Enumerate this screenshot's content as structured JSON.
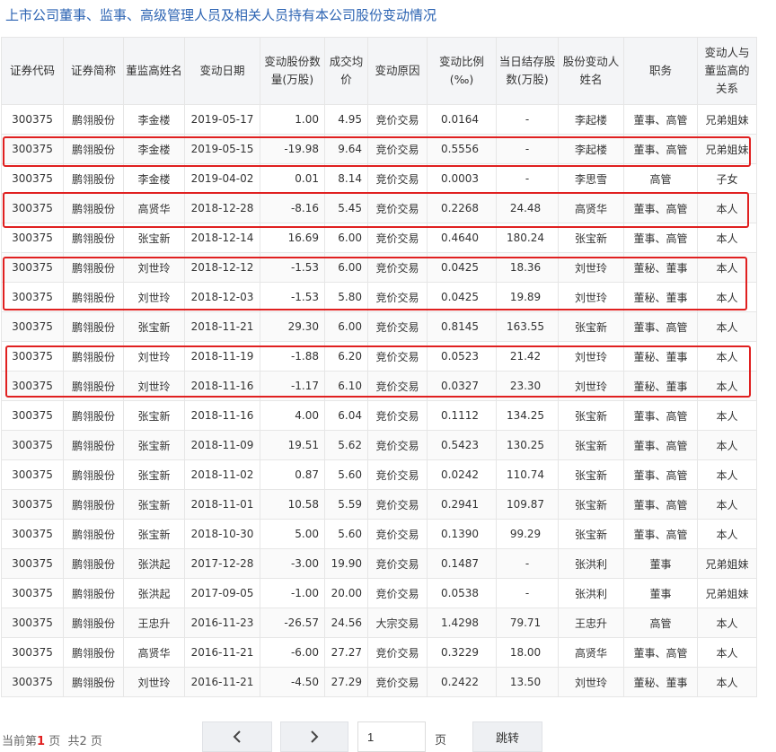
{
  "page_title": "上市公司董事、监事、高级管理人员及相关人员持有本公司股份变动情况",
  "table": {
    "headers": [
      "证券代码",
      "证券简称",
      "董监高姓名",
      "变动日期",
      "变动股份数量(万股)",
      "成交均价",
      "变动原因",
      "变动比例(‰)",
      "当日结存股数(万股)",
      "股份变动人姓名",
      "职务",
      "变动人与董监高的关系"
    ],
    "rows": [
      [
        "300375",
        "鹏翎股份",
        "李金楼",
        "2019-05-17",
        "1.00",
        "4.95",
        "竞价交易",
        "0.0164",
        "-",
        "李起楼",
        "董事、高管",
        "兄弟姐妹"
      ],
      [
        "300375",
        "鹏翎股份",
        "李金楼",
        "2019-05-15",
        "-19.98",
        "9.64",
        "竞价交易",
        "0.5556",
        "-",
        "李起楼",
        "董事、高管",
        "兄弟姐妹"
      ],
      [
        "300375",
        "鹏翎股份",
        "李金楼",
        "2019-04-02",
        "0.01",
        "8.14",
        "竞价交易",
        "0.0003",
        "-",
        "李思雪",
        "高管",
        "子女"
      ],
      [
        "300375",
        "鹏翎股份",
        "高贤华",
        "2018-12-28",
        "-8.16",
        "5.45",
        "竞价交易",
        "0.2268",
        "24.48",
        "高贤华",
        "董事、高管",
        "本人"
      ],
      [
        "300375",
        "鹏翎股份",
        "张宝新",
        "2018-12-14",
        "16.69",
        "6.00",
        "竞价交易",
        "0.4640",
        "180.24",
        "张宝新",
        "董事、高管",
        "本人"
      ],
      [
        "300375",
        "鹏翎股份",
        "刘世玲",
        "2018-12-12",
        "-1.53",
        "6.00",
        "竞价交易",
        "0.0425",
        "18.36",
        "刘世玲",
        "董秘、董事",
        "本人"
      ],
      [
        "300375",
        "鹏翎股份",
        "刘世玲",
        "2018-12-03",
        "-1.53",
        "5.80",
        "竞价交易",
        "0.0425",
        "19.89",
        "刘世玲",
        "董秘、董事",
        "本人"
      ],
      [
        "300375",
        "鹏翎股份",
        "张宝新",
        "2018-11-21",
        "29.30",
        "6.00",
        "竞价交易",
        "0.8145",
        "163.55",
        "张宝新",
        "董事、高管",
        "本人"
      ],
      [
        "300375",
        "鹏翎股份",
        "刘世玲",
        "2018-11-19",
        "-1.88",
        "6.20",
        "竞价交易",
        "0.0523",
        "21.42",
        "刘世玲",
        "董秘、董事",
        "本人"
      ],
      [
        "300375",
        "鹏翎股份",
        "刘世玲",
        "2018-11-16",
        "-1.17",
        "6.10",
        "竞价交易",
        "0.0327",
        "23.30",
        "刘世玲",
        "董秘、董事",
        "本人"
      ],
      [
        "300375",
        "鹏翎股份",
        "张宝新",
        "2018-11-16",
        "4.00",
        "6.04",
        "竞价交易",
        "0.1112",
        "134.25",
        "张宝新",
        "董事、高管",
        "本人"
      ],
      [
        "300375",
        "鹏翎股份",
        "张宝新",
        "2018-11-09",
        "19.51",
        "5.62",
        "竞价交易",
        "0.5423",
        "130.25",
        "张宝新",
        "董事、高管",
        "本人"
      ],
      [
        "300375",
        "鹏翎股份",
        "张宝新",
        "2018-11-02",
        "0.87",
        "5.60",
        "竞价交易",
        "0.0242",
        "110.74",
        "张宝新",
        "董事、高管",
        "本人"
      ],
      [
        "300375",
        "鹏翎股份",
        "张宝新",
        "2018-11-01",
        "10.58",
        "5.59",
        "竞价交易",
        "0.2941",
        "109.87",
        "张宝新",
        "董事、高管",
        "本人"
      ],
      [
        "300375",
        "鹏翎股份",
        "张宝新",
        "2018-10-30",
        "5.00",
        "5.60",
        "竞价交易",
        "0.1390",
        "99.29",
        "张宝新",
        "董事、高管",
        "本人"
      ],
      [
        "300375",
        "鹏翎股份",
        "张洪起",
        "2017-12-28",
        "-3.00",
        "19.90",
        "竞价交易",
        "0.1487",
        "-",
        "张洪利",
        "董事",
        "兄弟姐妹"
      ],
      [
        "300375",
        "鹏翎股份",
        "张洪起",
        "2017-09-05",
        "-1.00",
        "20.00",
        "竞价交易",
        "0.0538",
        "-",
        "张洪利",
        "董事",
        "兄弟姐妹"
      ],
      [
        "300375",
        "鹏翎股份",
        "王忠升",
        "2016-11-23",
        "-26.57",
        "24.56",
        "大宗交易",
        "1.4298",
        "79.71",
        "王忠升",
        "高管",
        "本人"
      ],
      [
        "300375",
        "鹏翎股份",
        "高贤华",
        "2016-11-21",
        "-6.00",
        "27.27",
        "竞价交易",
        "0.3229",
        "18.00",
        "高贤华",
        "董事、高管",
        "本人"
      ],
      [
        "300375",
        "鹏翎股份",
        "刘世玲",
        "2016-11-21",
        "-4.50",
        "27.29",
        "竞价交易",
        "0.2422",
        "13.50",
        "刘世玲",
        "董秘、董事",
        "本人"
      ]
    ]
  },
  "pager": {
    "prefix": "当前第",
    "current": "1",
    "page_word": "页",
    "total_text": "共2 页",
    "input_value": "1",
    "unit": "页",
    "jump_label": "跳转"
  },
  "colors": {
    "title": "#2d64b3",
    "highlight": "#e02020",
    "header_bg": "#f4f5f7"
  }
}
